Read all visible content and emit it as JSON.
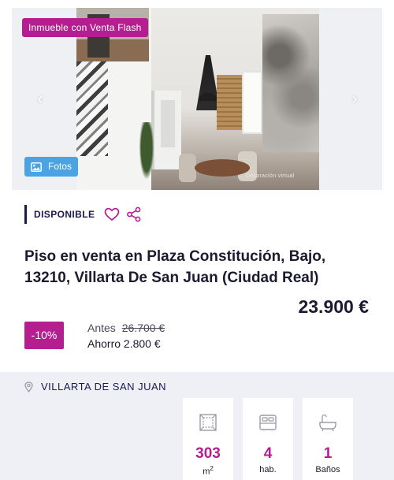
{
  "gallery": {
    "flash_badge": "Inmueble con Venta Flash",
    "photos_button": "Fotos",
    "watermark": "Decoración virtual",
    "icons": [
      "chevron-left-icon",
      "chevron-right-icon",
      "image-icon"
    ]
  },
  "status": {
    "label": "DISPONIBLE",
    "icons": [
      "heart-icon",
      "share-icon"
    ]
  },
  "listing": {
    "title": "Piso en venta en Plaza Constitución, Bajo, 13210, Villarta De San Juan (Ciudad Real)",
    "price": "23.900 €",
    "discount": "-10%",
    "before_label": "Antes",
    "before_price": "26.700 €",
    "saving": "Ahorro 2.800 €"
  },
  "location": {
    "icon": "map-pin-icon",
    "name": "VILLARTA DE SAN JUAN"
  },
  "features": [
    {
      "icon": "floor-plan-icon",
      "value": "303",
      "unit": "m",
      "unit_sup": "2"
    },
    {
      "icon": "bed-icon",
      "value": "4",
      "unit": "hab."
    },
    {
      "icon": "bathtub-icon",
      "value": "1",
      "unit": "Baños"
    }
  ],
  "colors": {
    "accent": "#b41e8e",
    "navy": "#1a1a4d",
    "photos_button": "#4ba3e3",
    "band": "#eef0f5"
  }
}
